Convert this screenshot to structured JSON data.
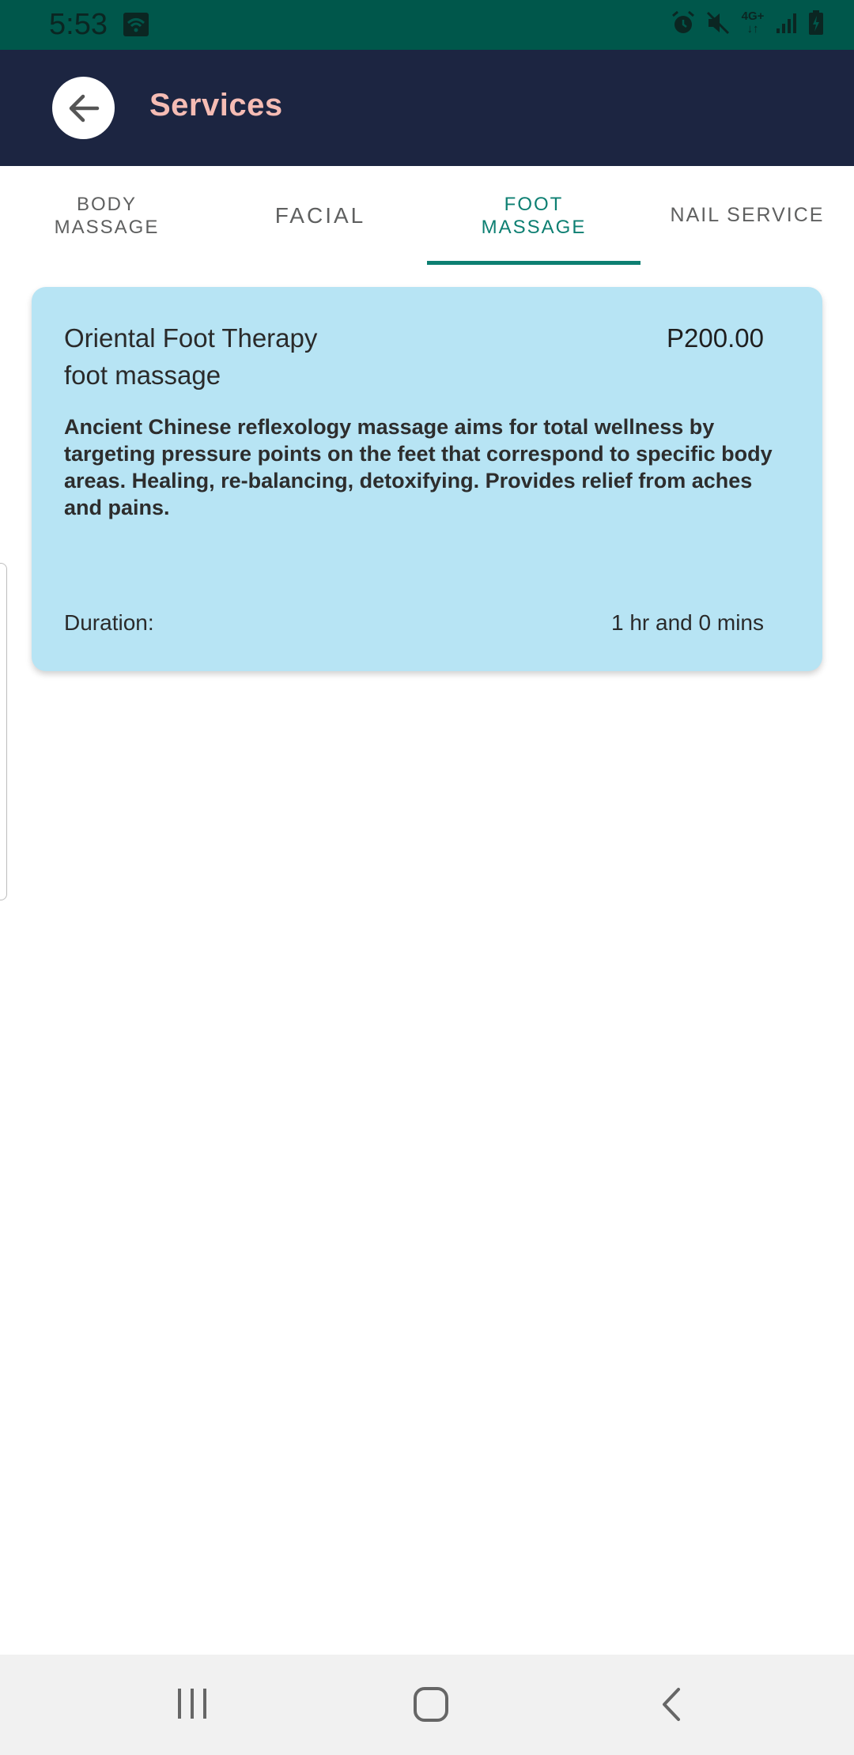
{
  "status_bar": {
    "time": "5:53",
    "network_label": "4G+",
    "icons": [
      "wifi-icon",
      "alarm-icon",
      "mute-icon",
      "signal-icon",
      "battery-charging-icon"
    ]
  },
  "app_bar": {
    "title": "Services",
    "back_icon": "arrow-left-icon"
  },
  "tabs": [
    {
      "label": "BODY\nMASSAGE",
      "active": false
    },
    {
      "label": "FACIAL",
      "active": false
    },
    {
      "label": "FOOT\nMASSAGE",
      "active": true
    },
    {
      "label": "NAIL SERVICE",
      "active": false
    }
  ],
  "service": {
    "name": "Oriental Foot Therapy",
    "category": "foot massage",
    "price": "P200.00",
    "description": "Ancient Chinese reflexology massage aims for total wellness by targeting pressure points on the feet that correspond to specific body areas. Healing, re-balancing, detoxifying. Provides relief from aches and pains.",
    "duration_label": "Duration:",
    "duration_value": "1 hr and 0 mins"
  },
  "colors": {
    "status_bar": "#00574b",
    "app_bar": "#1c2541",
    "title": "#f5bcb4",
    "accent": "#0d7f72",
    "card": "#b7e4f4"
  },
  "nav_bar": {
    "icons": [
      "recents-icon",
      "home-icon",
      "back-icon"
    ]
  }
}
